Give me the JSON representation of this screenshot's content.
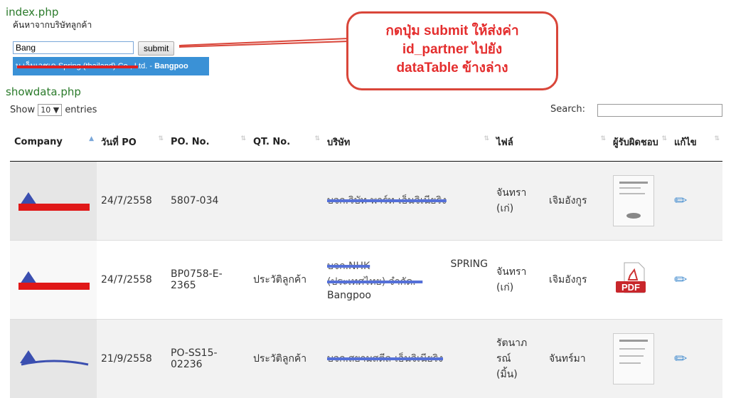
{
  "file_top": "index.php",
  "file_bottom": "showdata.php",
  "search": {
    "title": "ค้นหาจากบริษัทลูกค้า",
    "value": "Bang",
    "submit": "submit",
    "suggestion_prefix": "บ.เอ็นเอชเค Spring (thailand) Co., Ltd. - ",
    "suggestion_bold": "Bangpoo"
  },
  "callout": {
    "line1": "กดปุ่ม submit ให้ส่งค่า",
    "line2": "id_partner ไปยัง",
    "line3": "dataTable ข้างล่าง"
  },
  "table_controls": {
    "show": "Show",
    "length": "10 ▼",
    "entries": "entries",
    "search": "Search:"
  },
  "columns": [
    "Company",
    "วันที่ PO",
    "PO. No.",
    "QT. No.",
    "บริษัท",
    "ไฟล์",
    "",
    "ผู้รับผิดชอบ",
    "แก้ไข"
  ],
  "rows": [
    {
      "date": "24/7/2558",
      "po": "5807-034",
      "qt": "",
      "company": "บจก.วิบัท-พาร์ท-เอ็นจิเนียริง",
      "company_extra": "",
      "file1": "จันทรา",
      "file1b": "(เก่)",
      "file2": "เจิมอังกูร"
    },
    {
      "date": "24/7/2558",
      "po": "BP0758-E-2365",
      "qt": "ประวัติลูกค้า",
      "company": "บจก.NHK",
      "company_extra": "SPRING",
      "company_extra2": "(ประเทศไทย) จำกัด. -",
      "company_extra3": "Bangpoo",
      "file1": "จันทรา",
      "file1b": "(เก่)",
      "file2": "เจิมอังกูร"
    },
    {
      "date": "21/9/2558",
      "po": "PO-SS15-02236",
      "qt": "ประวัติลูกค้า",
      "company": "บจก.สยามสตีล-เอ็นจิเนียริง",
      "company_extra": "",
      "file1": "รัตนาภรณ์",
      "file1b": "(มิ้น)",
      "file2": "จันทร์มา"
    }
  ]
}
